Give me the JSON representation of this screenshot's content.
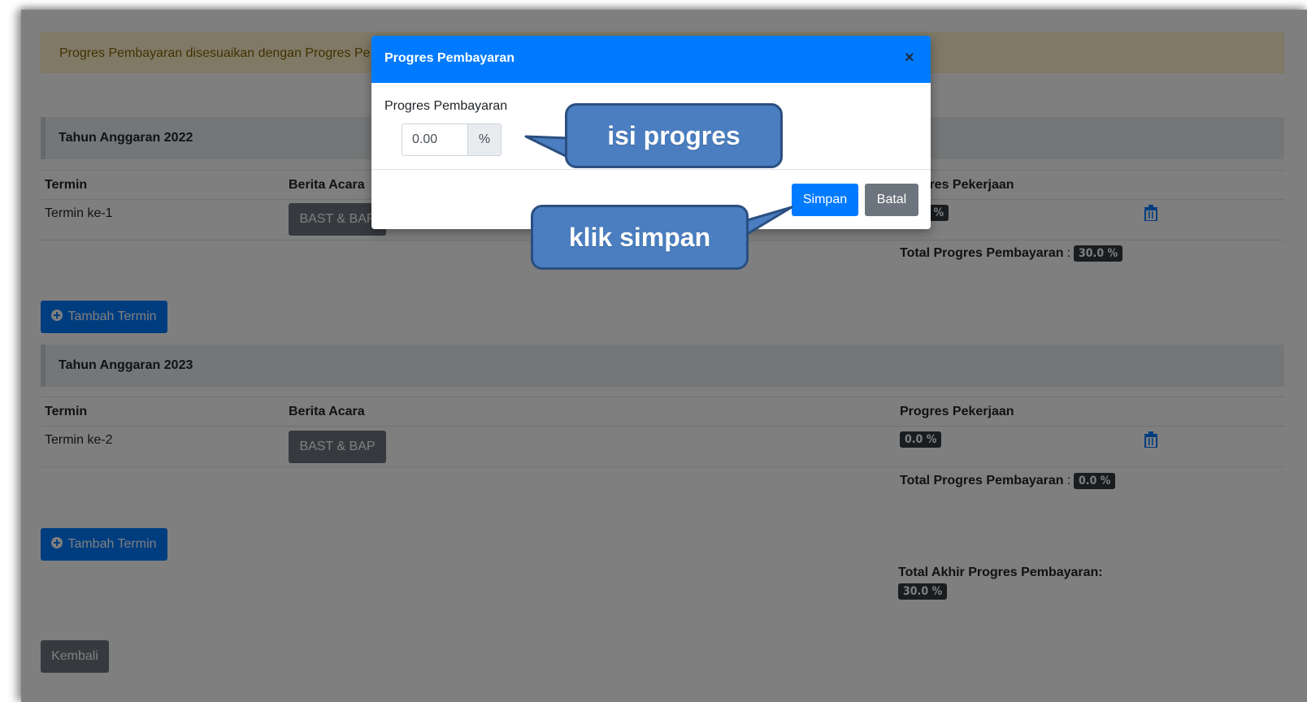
{
  "alert": {
    "text": "Progres Pembayaran disesuaikan dengan Progres Pe"
  },
  "section2022": {
    "title": "Tahun Anggaran 2022",
    "col_termin": "Termin",
    "col_berita": "Berita Acara",
    "col_progres": "Progres Pekerjaan",
    "row_termin": "Termin ke-1",
    "row_berita_btn": "BAST & BAP",
    "row_progres": "30.0 %",
    "total_label": "Total Progres Pembayaran",
    "total_value": "30.0 %",
    "add_btn": "Tambah Termin"
  },
  "section2023": {
    "title": "Tahun Anggaran 2023",
    "col_termin": "Termin",
    "col_berita": "Berita Acara",
    "col_progres": "Progres Pekerjaan",
    "row_termin": "Termin ke-2",
    "row_berita_btn": "BAST & BAP",
    "row_progres": "0.0 %",
    "total_label": "Total Progres Pembayaran",
    "total_value": "0.0 %",
    "add_btn": "Tambah Termin"
  },
  "final": {
    "label": "Total Akhir Progres Pembayaran:",
    "value": "30.0 %"
  },
  "back_btn": "Kembali",
  "modal": {
    "title": "Progres Pembayaran",
    "close": "×",
    "field_label": "Progres Pembayaran",
    "input_value": "0.00",
    "input_unit": "%",
    "save": "Simpan",
    "cancel": "Batal"
  },
  "callouts": {
    "fill": "isi progres",
    "save": "klik simpan"
  },
  "colors": {
    "primary": "#007bff",
    "secondary": "#6c757d",
    "callout": "#4a7ec0"
  }
}
